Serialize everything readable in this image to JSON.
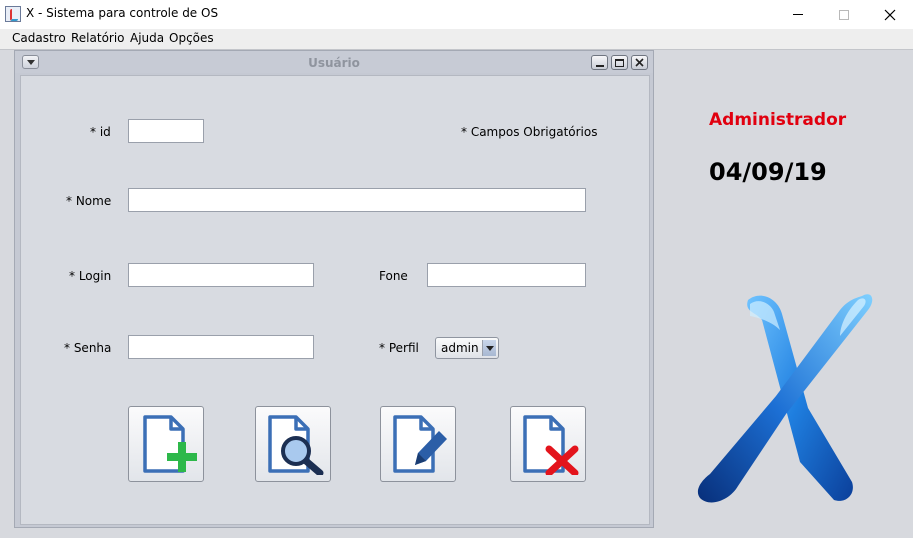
{
  "window": {
    "title": "X - Sistema para controle de OS",
    "icon": "java-cup-icon"
  },
  "menu": [
    "Cadastro",
    "Relatório",
    "Ajuda",
    "Opções"
  ],
  "frame": {
    "title": "Usuário"
  },
  "form": {
    "id_label": "* id",
    "required_note": "* Campos Obrigatórios",
    "nome_label": "* Nome",
    "login_label": "* Login",
    "fone_label": "Fone",
    "senha_label": "* Senha",
    "perfil_label": "* Perfil",
    "perfil_value": "admin",
    "id_value": "",
    "nome_value": "",
    "login_value": "",
    "fone_value": "",
    "senha_value": ""
  },
  "actions": [
    {
      "icon": "document-add-icon",
      "accent": "#2db84a"
    },
    {
      "icon": "document-search-icon",
      "accent": "#3b6fb6"
    },
    {
      "icon": "document-edit-icon",
      "accent": "#2b5ea7"
    },
    {
      "icon": "document-delete-icon",
      "accent": "#e3141c"
    }
  ],
  "status": {
    "role": "Administrador",
    "date": "04/09/19"
  },
  "colors": {
    "role": "#e1000f",
    "logo": "#1f6fd0",
    "desktop": "#d7d9de"
  }
}
